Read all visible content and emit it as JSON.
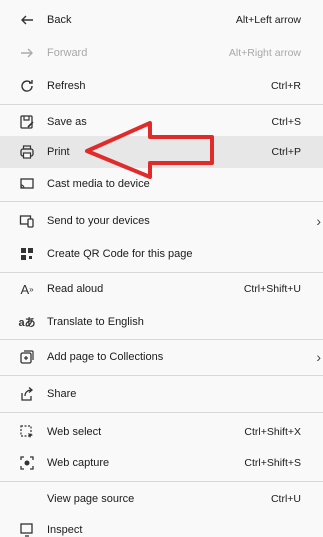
{
  "menu": {
    "back": {
      "label": "Back",
      "shortcut": "Alt+Left arrow",
      "icon": "back-arrow-icon"
    },
    "forward": {
      "label": "Forward",
      "shortcut": "Alt+Right arrow",
      "icon": "forward-arrow-icon"
    },
    "refresh": {
      "label": "Refresh",
      "shortcut": "Ctrl+R",
      "icon": "refresh-icon"
    },
    "save_as": {
      "label": "Save as",
      "shortcut": "Ctrl+S",
      "icon": "save-as-icon"
    },
    "print": {
      "label": "Print",
      "shortcut": "Ctrl+P",
      "icon": "printer-icon"
    },
    "cast": {
      "label": "Cast media to device",
      "icon": "cast-icon"
    },
    "send": {
      "label": "Send to your devices",
      "icon": "send-to-devices-icon"
    },
    "qr": {
      "label": "Create QR Code for this page",
      "icon": "qr-code-icon"
    },
    "read_aloud": {
      "label": "Read aloud",
      "shortcut": "Ctrl+Shift+U",
      "icon": "read-aloud-icon"
    },
    "translate": {
      "label": "Translate to English",
      "icon": "translate-icon"
    },
    "collections": {
      "label": "Add page to Collections",
      "icon": "collections-icon"
    },
    "share": {
      "label": "Share",
      "icon": "share-icon"
    },
    "web_select": {
      "label": "Web select",
      "shortcut": "Ctrl+Shift+X",
      "icon": "web-select-icon"
    },
    "web_capture": {
      "label": "Web capture",
      "shortcut": "Ctrl+Shift+S",
      "icon": "web-capture-icon"
    },
    "view_source": {
      "label": "View page source",
      "shortcut": "Ctrl+U"
    },
    "inspect": {
      "label": "Inspect",
      "icon": "inspect-icon"
    }
  },
  "annotation": {
    "arrow_color": "#e02b2b",
    "icon": "red-callout-arrow-icon"
  }
}
